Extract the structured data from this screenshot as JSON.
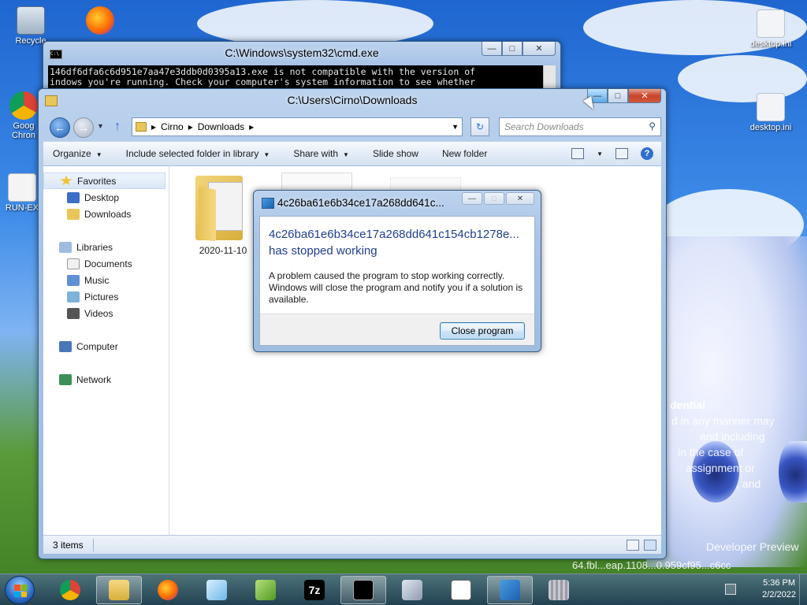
{
  "desktop": {
    "icons": [
      {
        "label": "Recycle"
      },
      {
        "label": "Goog Chron"
      },
      {
        "label": "RUN-EX"
      },
      {
        "label": "desktop.ini"
      },
      {
        "label": "desktop.ini"
      }
    ],
    "wallpaper_text": [
      "dential",
      "d in any manner may",
      "and including",
      "in the case of",
      "assignment or",
      ", and",
      "Developer Preview",
      "64.fbl...eap.1108...0.959cf95...c6cc"
    ]
  },
  "cmd": {
    "title": "C:\\Windows\\system32\\cmd.exe",
    "line1": "146df6dfa6c6d951e7aa47e3ddb0d0395a13.exe is not compatible with the version of",
    "line2": "indows you're running. Check your computer's system information to see whether"
  },
  "explorer": {
    "title": "C:\\Users\\Cirno\\Downloads",
    "breadcrumb": [
      "Cirno",
      "Downloads"
    ],
    "search_placeholder": "Search Downloads",
    "toolbar": {
      "organize": "Organize",
      "include": "Include selected folder in library",
      "share": "Share with",
      "slideshow": "Slide show",
      "new_folder": "New folder"
    },
    "nav": {
      "favorites": "Favorites",
      "desktop": "Desktop",
      "downloads": "Downloads",
      "libraries": "Libraries",
      "documents": "Documents",
      "music": "Music",
      "pictures": "Pictures",
      "videos": "Videos",
      "computer": "Computer",
      "network": "Network"
    },
    "files": [
      {
        "name": "2020-11-10"
      }
    ],
    "status": "3 items"
  },
  "dialog": {
    "title": "4c26ba61e6b34ce17a268dd641c...",
    "head_line1": "4c26ba61e6b34ce17a268dd641c154cb1278e...",
    "head_line2": "has stopped working",
    "text_line1": "A problem caused the program to stop working correctly.",
    "text_line2": "Windows will close the program and notify you if a solution is",
    "text_line3": "available.",
    "button": "Close program"
  },
  "taskbar": {
    "time": "5:36 PM",
    "date": "2/2/2022"
  },
  "colors": {
    "accent": "#1f3f8f",
    "close_red": "#c7442a",
    "taskbar": "#1e375a"
  }
}
